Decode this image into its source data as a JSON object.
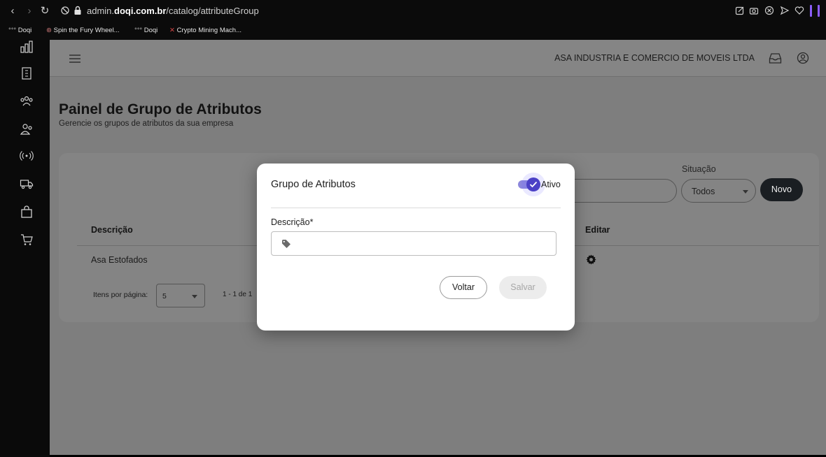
{
  "browser": {
    "url_prefix": "admin.",
    "url_domain": "doqi.com.br",
    "url_path": "/catalog/attributeGroup",
    "bookmarks": [
      {
        "label": "Doqi"
      },
      {
        "label": "Spin the Fury Wheel..."
      },
      {
        "label": "Doqi"
      },
      {
        "label": "Crypto Mining Mach..."
      }
    ]
  },
  "header": {
    "company_name": "ASA INDUSTRIA E COMERCIO DE MOVEIS LTDA"
  },
  "page": {
    "title": "Painel de Grupo de Atributos",
    "subtitle": "Gerencie os grupos de atributos da sua empresa"
  },
  "filters": {
    "situacao_label": "Situação",
    "situacao_value": "Todos",
    "new_button": "Novo"
  },
  "table": {
    "columns": [
      "Descrição",
      "Editar"
    ],
    "rows": [
      {
        "descricao": "Asa Estofados"
      }
    ]
  },
  "pagination": {
    "items_per_page_label": "Itens por página:",
    "items_per_page_value": "5",
    "range": "1 - 1 de 1"
  },
  "modal": {
    "title": "Grupo de Atributos",
    "toggle_label": "Ativo",
    "toggle_on": true,
    "field_label": "Descrição*",
    "field_value": "",
    "back_button": "Voltar",
    "save_button": "Salvar"
  },
  "colors": {
    "accent": "#4b41c6",
    "primary_dark": "#1a1e22",
    "sidebar": "#0a0a0a"
  }
}
